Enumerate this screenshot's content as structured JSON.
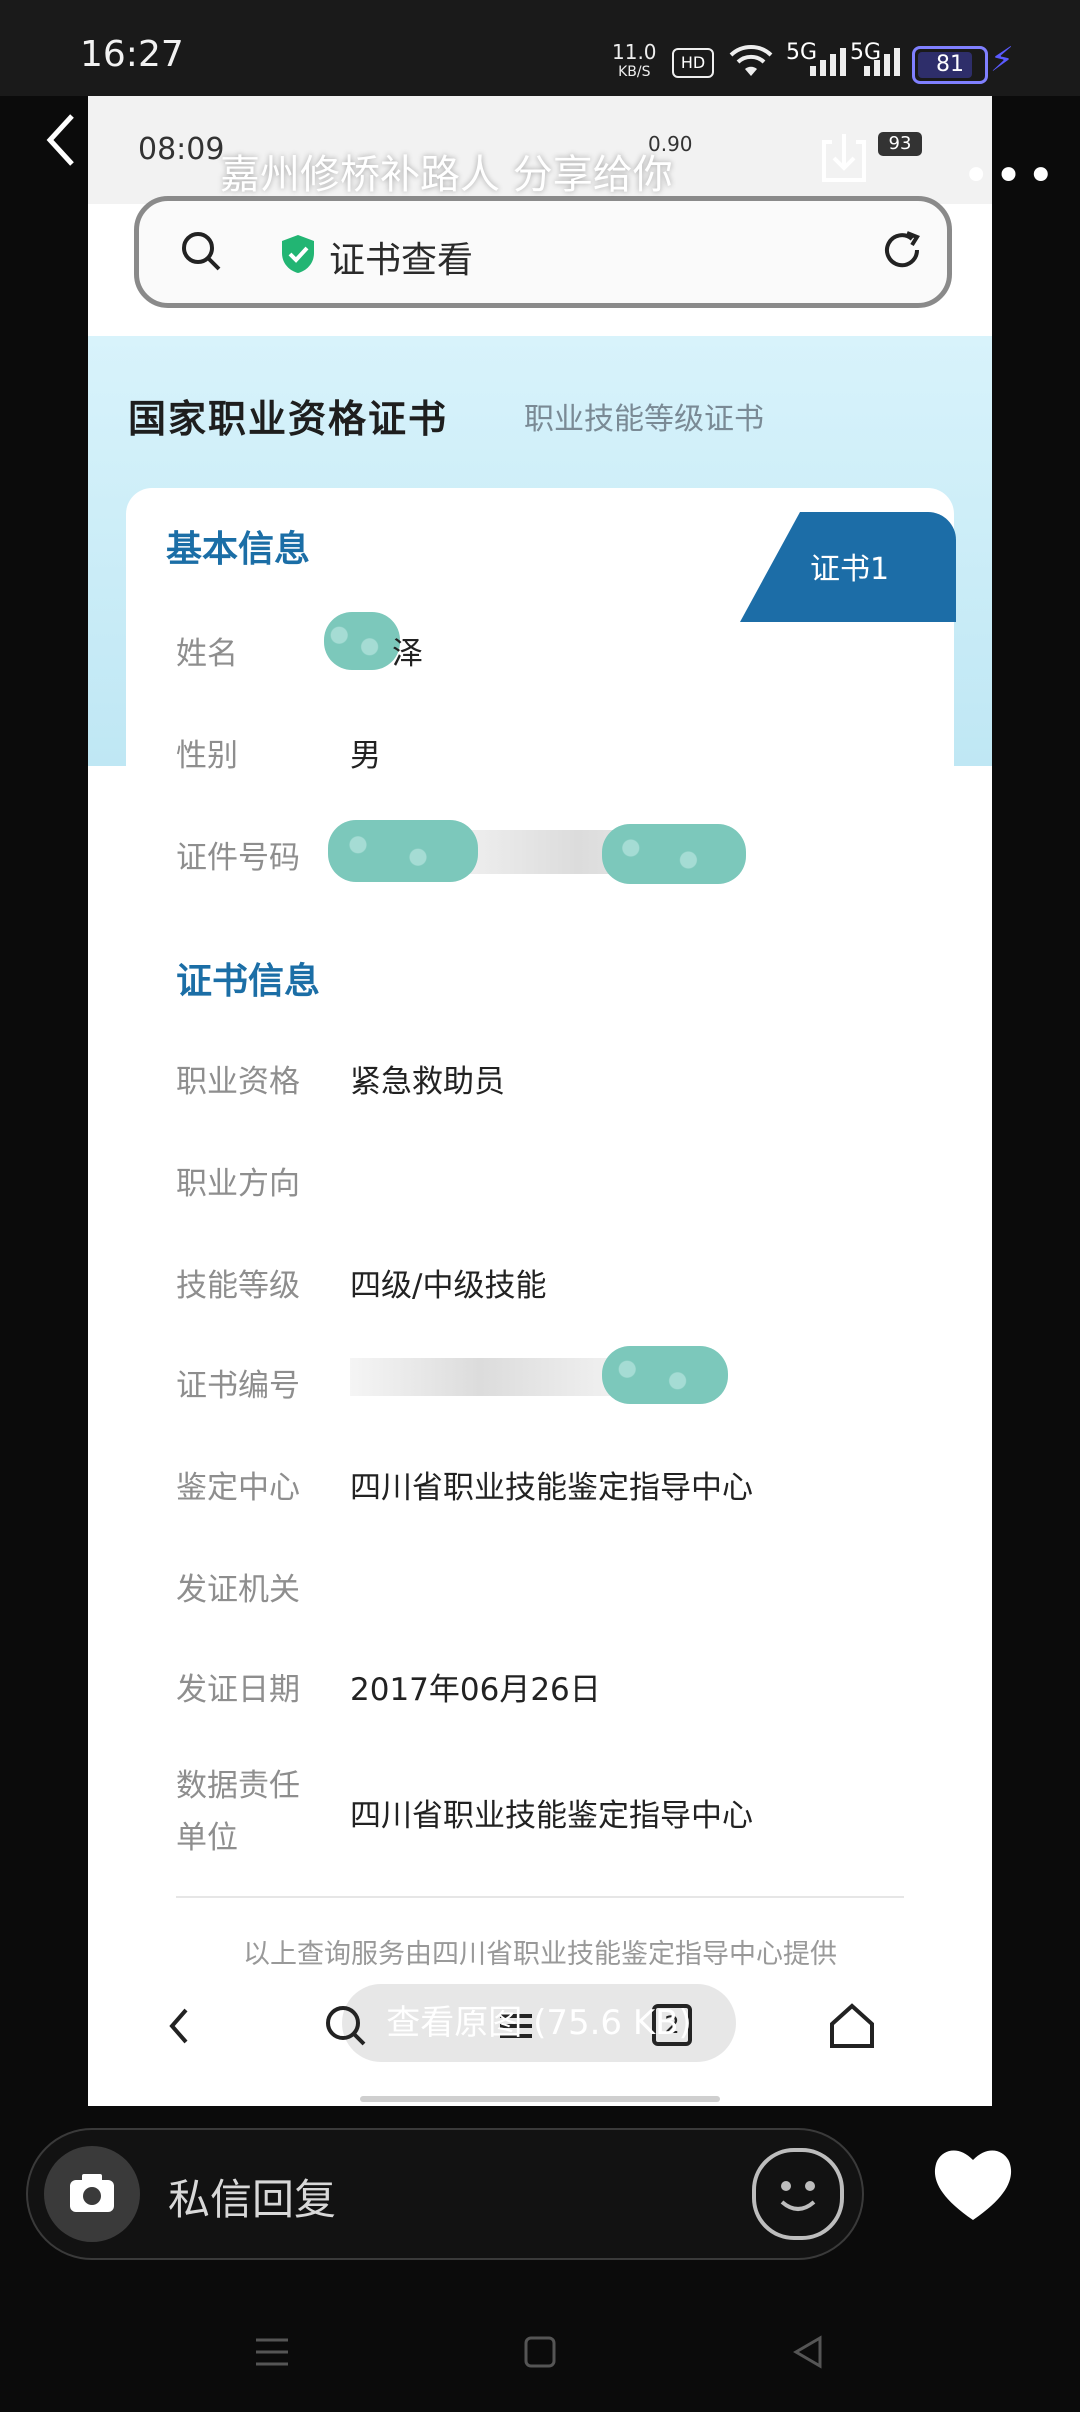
{
  "status_bar": {
    "time": "16:27",
    "net_rate_value": "11.0",
    "net_rate_unit": "KB/S",
    "hd_label": "HD",
    "sim1_label": "5G",
    "sim2_label": "5G",
    "battery": "81"
  },
  "overlay": {
    "share_text": "嘉州修桥补路人 分享给你",
    "view_original": "查看原图 (75.6 KB)"
  },
  "inner_status": {
    "time": "08:09",
    "rate": "0.90",
    "battery": "93"
  },
  "browser": {
    "title": "证书查看"
  },
  "hero": {
    "title": "国家职业资格证书",
    "subtitle": "职业技能等级证书"
  },
  "certificate": {
    "tab_label": "证书1",
    "basic_section": "基本信息",
    "basic": [
      {
        "label": "姓名",
        "value": "泽"
      },
      {
        "label": "性别",
        "value": "男"
      },
      {
        "label": "证件号码",
        "value": ""
      }
    ],
    "cert_section": "证书信息",
    "fields": [
      {
        "label": "职业资格",
        "value": "紧急救助员"
      },
      {
        "label": "职业方向",
        "value": ""
      },
      {
        "label": "技能等级",
        "value": "四级/中级技能"
      },
      {
        "label": "证书编号",
        "value": ""
      },
      {
        "label": "鉴定中心",
        "value": "四川省职业技能鉴定指导中心"
      },
      {
        "label": "发证机关",
        "value": ""
      },
      {
        "label": "发证日期",
        "value": "2017年06月26日"
      },
      {
        "label": "数据责任单位",
        "value": "四川省职业技能鉴定指导中心"
      }
    ],
    "footer": "以上查询服务由四川省职业技能鉴定指导中心提供"
  },
  "inner_nav": {
    "tabs_count": "2"
  },
  "reply": {
    "placeholder": "私信回复"
  },
  "icons": {
    "back": "chevron-left-icon",
    "download": "download-icon",
    "more": "more-icon",
    "camera": "camera-icon",
    "emoji": "emoji-icon",
    "heart": "heart-icon"
  }
}
